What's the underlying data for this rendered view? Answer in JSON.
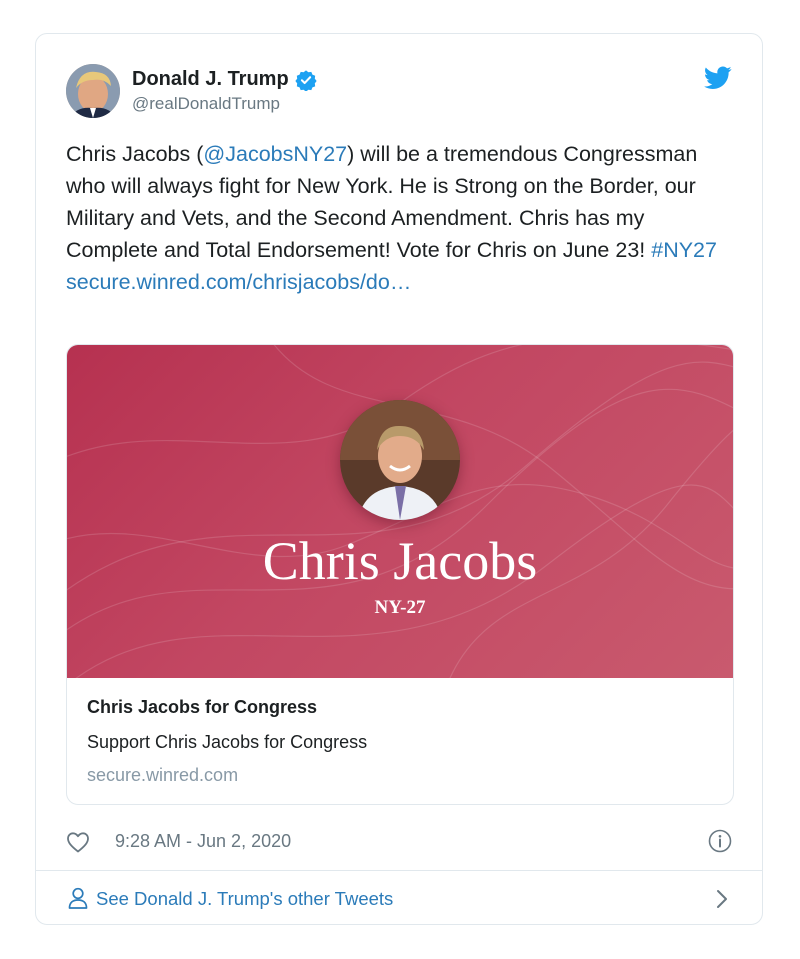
{
  "tweet": {
    "author_name": "Donald J. Trump",
    "handle": "@realDonaldTrump",
    "verified": true,
    "text": {
      "part1": "Chris Jacobs (",
      "mention": "@JacobsNY27",
      "part2": ") will be a tremendous Congressman who will always fight for New York. He is Strong on the Border, our Military and Vets, and the Second Amendment. Chris has my Complete and Total Endorsement! Vote for Chris on June 23! ",
      "hashtag": "#NY27",
      "link": "secure.winred.com/chrisjacobs/do…"
    },
    "timestamp": "9:28 AM - Jun 2, 2020"
  },
  "link_card": {
    "banner_name": "Chris Jacobs",
    "banner_sub": "NY-27",
    "title": "Chris Jacobs for Congress",
    "description": "Support Chris Jacobs for Congress",
    "domain": "secure.winred.com"
  },
  "footer": {
    "label": "See Donald J. Trump's other Tweets"
  },
  "colors": {
    "link": "#2b7bb9",
    "twitter_blue": "#1da1f2",
    "banner_red": "#c24762",
    "muted": "#697882"
  },
  "icons": [
    "twitter-bird-icon",
    "verified-badge-icon",
    "heart-icon",
    "info-icon",
    "user-icon",
    "chevron-right-icon"
  ]
}
